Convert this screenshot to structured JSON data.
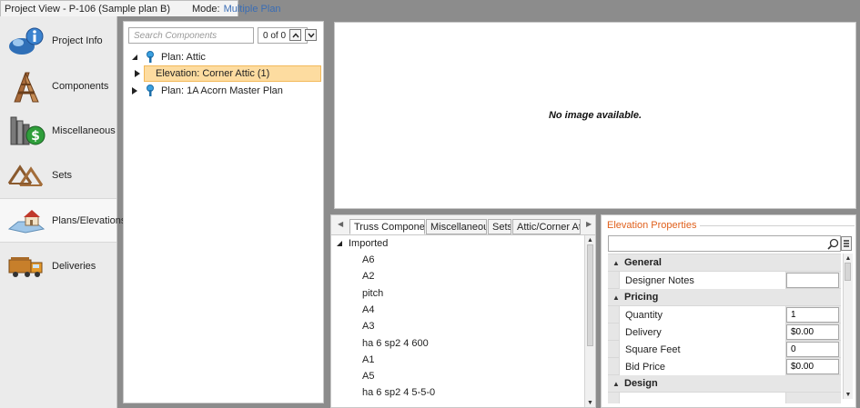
{
  "window": {
    "title": "Project View - P-106 (Sample plan B)",
    "mode_label": "Mode:",
    "mode_value": "Multiple Plan"
  },
  "nav": {
    "items": [
      {
        "label": "Project Info",
        "icon": "project-info-icon",
        "active": false
      },
      {
        "label": "Components",
        "icon": "components-icon",
        "active": false
      },
      {
        "label": "Miscellaneous",
        "icon": "miscellaneous-icon",
        "active": false
      },
      {
        "label": "Sets",
        "icon": "sets-icon",
        "active": false
      },
      {
        "label": "Plans/Elevations",
        "icon": "plans-elevations-icon",
        "active": true
      },
      {
        "label": "Deliveries",
        "icon": "deliveries-icon",
        "active": false
      }
    ]
  },
  "tree": {
    "search_placeholder": "Search Components",
    "match_count": "0 of 0",
    "nodes": [
      {
        "label": "Plan:  Attic",
        "expanded": true
      },
      {
        "label": "Elevation:  Corner Attic (1)",
        "selected": true
      },
      {
        "label": "Plan:  1A Acorn Master Plan",
        "expanded": false
      }
    ]
  },
  "image_panel": {
    "message": "No image available."
  },
  "bottom_tabs": {
    "tabs": [
      {
        "label": "Truss Components",
        "active": true
      },
      {
        "label": "Miscellaneous",
        "active": false
      },
      {
        "label": "Sets",
        "active": false
      },
      {
        "label": "Attic/Corner Attic",
        "active": false
      }
    ],
    "group": "Imported",
    "items": [
      "A6",
      "A2",
      "pitch",
      "A4",
      "A3",
      "ha 6 sp2 4 600",
      "A1",
      "A5",
      "ha 6 sp2 4 5-5-0"
    ]
  },
  "properties": {
    "title": "Elevation Properties",
    "categories": {
      "general": "General",
      "pricing": "Pricing",
      "design": "Design"
    },
    "rows": {
      "designer_notes": {
        "name": "Designer Notes",
        "value": ""
      },
      "quantity": {
        "name": "Quantity",
        "value": "1"
      },
      "delivery": {
        "name": "Delivery",
        "value": "$0.00"
      },
      "square_feet": {
        "name": "Square Feet",
        "value": "0"
      },
      "bid_price": {
        "name": "Bid Price",
        "value": "$0.00"
      }
    }
  },
  "colors": {
    "selection_fill": "#fddca0",
    "selection_border": "#f3b95a",
    "property_title": "#e0601c",
    "mode_value": "#3a6db5",
    "frame_gray": "#8c8c8c"
  }
}
